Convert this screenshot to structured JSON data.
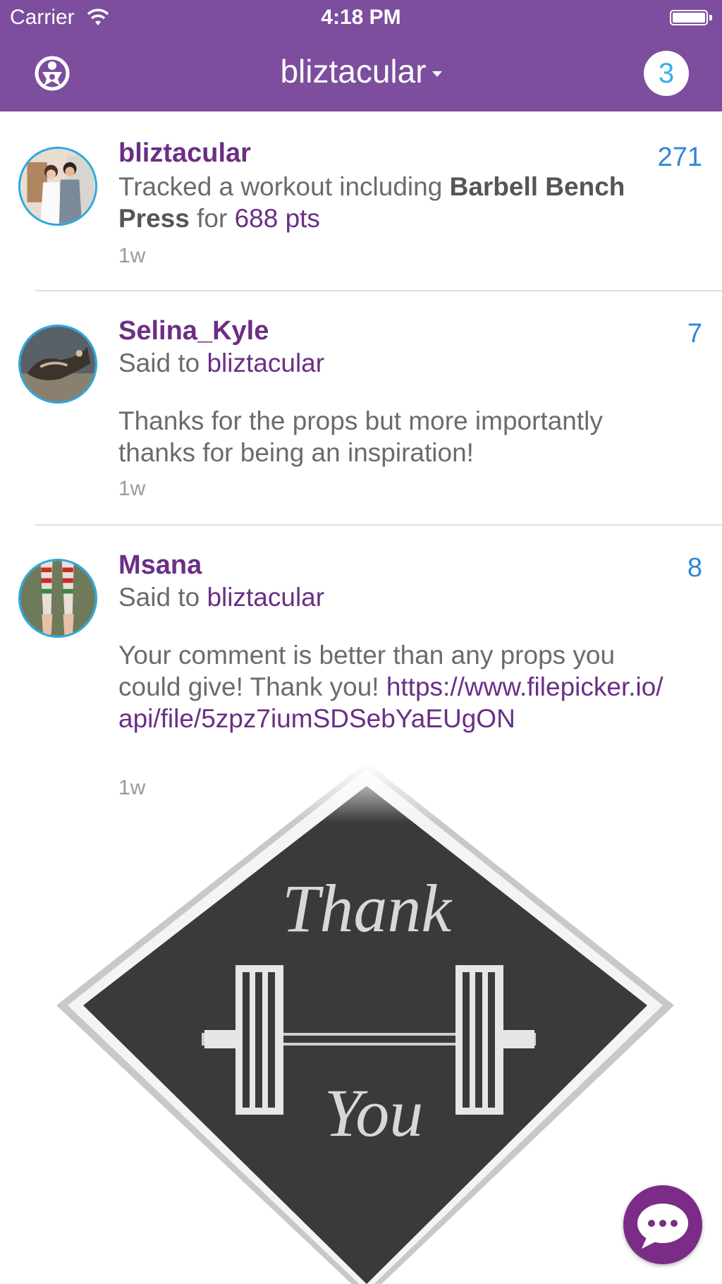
{
  "status_bar": {
    "carrier": "Carrier",
    "time": "4:18 PM"
  },
  "nav": {
    "title": "bliztacular",
    "notifications": "3"
  },
  "feed": [
    {
      "user": "bliztacular",
      "count": "271",
      "text_prefix": "Tracked a workout including ",
      "exercise": "Barbell Bench Press",
      "text_mid": " for ",
      "points": "688 pts",
      "time": "1w"
    },
    {
      "user": "Selina_Kyle",
      "count": "7",
      "said_to": "Said to ",
      "target": "bliztacular",
      "message": "Thanks for the props but more importantly thanks for being an inspiration!",
      "time": "1w"
    },
    {
      "user": "Msana",
      "count": "8",
      "said_to": "Said to ",
      "target": "bliztacular",
      "message": "Your comment is better than any props you could give! Thank you!  ",
      "link": "https://www.filepicker.io/api/file/5zpz7iumSDSebYaEUgON",
      "time": "1w"
    }
  ],
  "image_card": {
    "top_word": "Thank",
    "bottom_word": "You"
  },
  "colors": {
    "header": "#7c4e9d",
    "username": "#6a2f86",
    "count": "#2e86d8",
    "avatar_ring": "#2aa8e0"
  }
}
